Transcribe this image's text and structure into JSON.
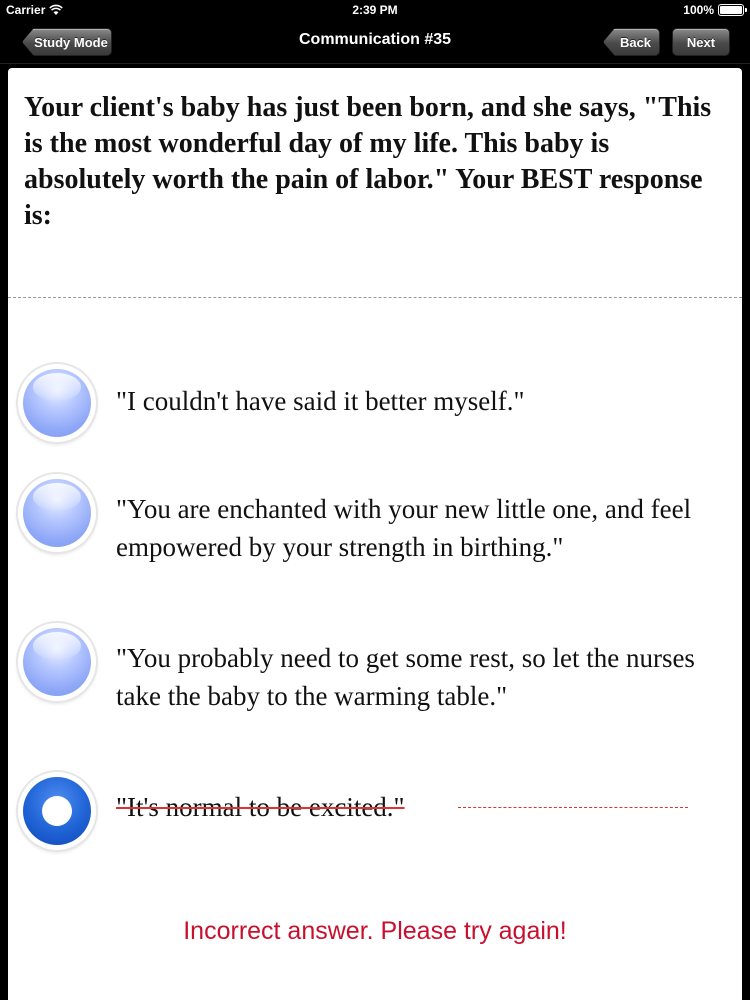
{
  "status": {
    "carrier": "Carrier",
    "time": "2:39 PM",
    "battery": "100%"
  },
  "nav": {
    "left_button": "Study Mode",
    "title": "Communication #35",
    "back_button": "Back",
    "next_button": "Next"
  },
  "question": "Your client's baby has just been born, and she says, \"This is the most wonderful day of my life. This baby is absolutely worth the pain of labor.\" Your BEST response is:",
  "options": [
    {
      "text": "\"I couldn't have said it better myself.\"",
      "selected": false,
      "struck": false
    },
    {
      "text": "\"You are enchanted with your new little one, and feel empowered by your strength in birthing.\"",
      "selected": false,
      "struck": false
    },
    {
      "text": "\"You probably need to get some rest, so let the nurses take the baby to the warming table.\"",
      "selected": false,
      "struck": false
    },
    {
      "text": "\"It's normal to be excited.\"",
      "selected": true,
      "struck": true
    }
  ],
  "feedback": "Incorrect answer. Please try again!",
  "colors": {
    "feedback": "#c8102e",
    "strike": "#dd3333",
    "radio_selected": "#2266d8",
    "radio_idle": "#8fa8f7"
  }
}
